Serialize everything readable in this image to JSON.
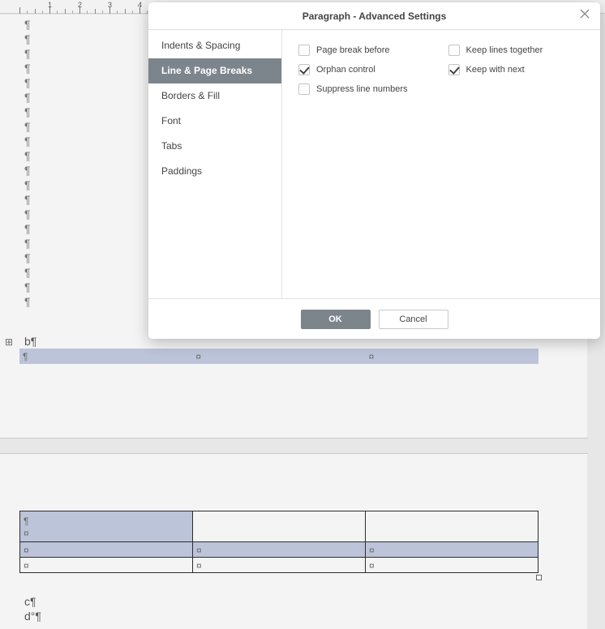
{
  "ruler": {
    "units": [
      1,
      2,
      3,
      4
    ]
  },
  "pilcrows": {
    "count": 20,
    "mark": "¶"
  },
  "b_line": "b¶",
  "table1_mark": "¤",
  "table2_mark": "¤",
  "after_text": {
    "line1": "c¶",
    "line2": "d°¶"
  },
  "dialog": {
    "title": "Paragraph - Advanced Settings",
    "nav": {
      "indents": "Indents & Spacing",
      "linepage": "Line & Page Breaks",
      "borders": "Borders & Fill",
      "font": "Font",
      "tabs": "Tabs",
      "paddings": "Paddings"
    },
    "checks": {
      "page_break": "Page break before",
      "orphan": "Orphan control",
      "suppress": "Suppress line numbers",
      "keep_lines": "Keep lines together",
      "keep_next": "Keep with next"
    },
    "ok": "OK",
    "cancel": "Cancel"
  }
}
